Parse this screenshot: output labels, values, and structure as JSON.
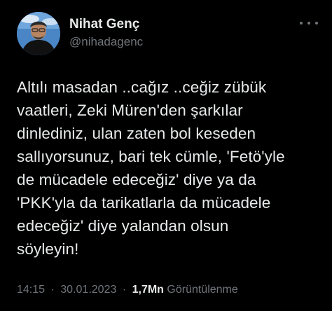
{
  "author": {
    "display_name": "Nihat Genç",
    "handle": "@nihadagenc"
  },
  "tweet": {
    "text": "Altılı masadan ..cağız ..ceğiz zübük\nvaatleri, Zeki Müren'den şarkılar\ndinlediniz, ulan zaten bol keseden\nsallıyorsunuz, bari tek cümle, 'Fetö'yle\nde mücadele edeceğiz' diye ya da\n'PKK'yla da tarikatlarla da mücadele\nedeceğiz' diye yalandan olsun\nsöyleyin!"
  },
  "meta": {
    "time": "14:15",
    "separator": "·",
    "date": "30.01.2023",
    "views_count": "1,7Mn",
    "views_label": "Görüntülenme"
  },
  "icons": {
    "more": "more-horizontal-icon"
  },
  "colors": {
    "background": "#000000",
    "primary_text": "#e7e9ea",
    "secondary_text": "#71767b"
  }
}
